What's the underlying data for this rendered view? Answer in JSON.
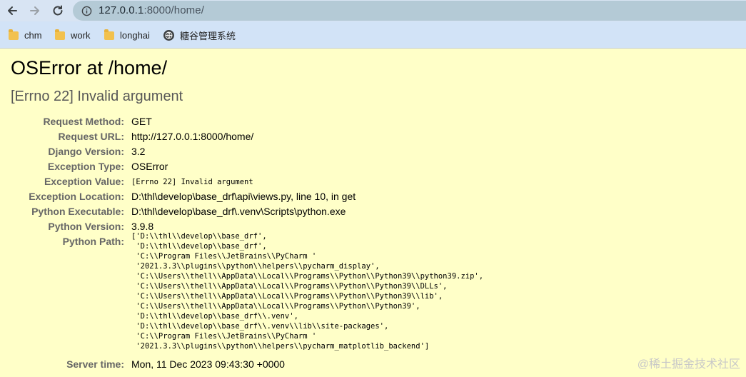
{
  "browser": {
    "url_host": "127.0.0.1",
    "url_path": ":8000/home/",
    "bookmarks": [
      {
        "label": "chm",
        "icon": "folder-icon"
      },
      {
        "label": "work",
        "icon": "folder-icon"
      },
      {
        "label": "longhai",
        "icon": "folder-icon"
      },
      {
        "label": "糖谷管理系统",
        "icon": "globe-icon"
      }
    ]
  },
  "page": {
    "title": "OSError at /home/",
    "subtitle": "[Errno 22] Invalid argument"
  },
  "meta": {
    "request_method": {
      "key": "Request Method:",
      "value": "GET"
    },
    "request_url": {
      "key": "Request URL:",
      "value": "http://127.0.0.1:8000/home/"
    },
    "django_version": {
      "key": "Django Version:",
      "value": "3.2"
    },
    "exception_type": {
      "key": "Exception Type:",
      "value": "OSError"
    },
    "exception_value": {
      "key": "Exception Value:",
      "value": "[Errno 22] Invalid argument"
    },
    "exception_location": {
      "key": "Exception Location:",
      "value": "D:\\thl\\develop\\base_drf\\api\\views.py, line 10, in get"
    },
    "python_executable": {
      "key": "Python Executable:",
      "value": "D:\\thl\\develop\\base_drf\\.venv\\Scripts\\python.exe"
    },
    "python_version": {
      "key": "Python Version:",
      "value": "3.9.8"
    },
    "python_path": {
      "key": "Python Path:",
      "lines": [
        "['D:\\\\thl\\\\develop\\\\base_drf',",
        " 'D:\\\\thl\\\\develop\\\\base_drf',",
        " 'C:\\\\Program Files\\\\JetBrains\\\\PyCharm '",
        " '2021.3.3\\\\plugins\\\\python\\\\helpers\\\\pycharm_display',",
        " 'C:\\\\Users\\\\thell\\\\AppData\\\\Local\\\\Programs\\\\Python\\\\Python39\\\\python39.zip',",
        " 'C:\\\\Users\\\\thell\\\\AppData\\\\Local\\\\Programs\\\\Python\\\\Python39\\\\DLLs',",
        " 'C:\\\\Users\\\\thell\\\\AppData\\\\Local\\\\Programs\\\\Python\\\\Python39\\\\lib',",
        " 'C:\\\\Users\\\\thell\\\\AppData\\\\Local\\\\Programs\\\\Python\\\\Python39',",
        " 'D:\\\\thl\\\\develop\\\\base_drf\\\\.venv',",
        " 'D:\\\\thl\\\\develop\\\\base_drf\\\\.venv\\\\lib\\\\site-packages',",
        " 'C:\\\\Program Files\\\\JetBrains\\\\PyCharm '",
        " '2021.3.3\\\\plugins\\\\python\\\\helpers\\\\pycharm_matplotlib_backend']"
      ]
    },
    "server_time": {
      "key": "Server time:",
      "value": "Mon, 11 Dec 2023 09:43:30 +0000"
    }
  },
  "watermark": "@稀土掘金技术社区",
  "colors": {
    "page_bg": "#ffffc8",
    "key_text": "#666666",
    "address_bar": "#b4cad6"
  }
}
